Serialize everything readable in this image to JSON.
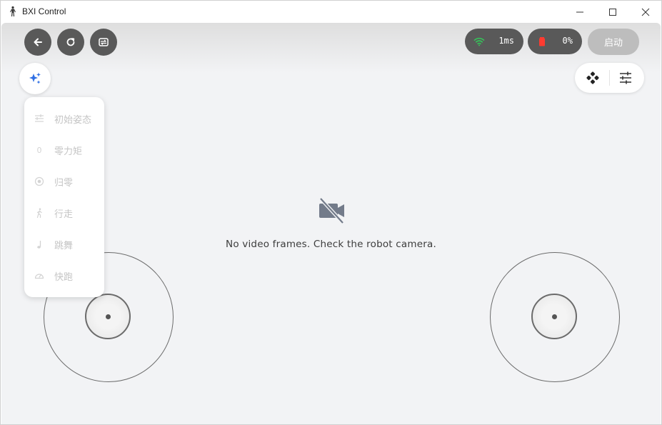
{
  "window": {
    "title": "BXI Control",
    "icons": {
      "app": "robot-figure-icon",
      "minimize": "minimize-icon",
      "maximize": "maximize-icon",
      "close": "close-icon"
    }
  },
  "toolbar": {
    "back_icon": "arrow-left-icon",
    "refresh_icon": "refresh-icon",
    "switch_icon": "switch-icon",
    "latency": {
      "icon": "wifi-icon",
      "value": "1ms",
      "icon_color": "#34c759"
    },
    "battery": {
      "icon": "battery-icon",
      "value": "0%",
      "icon_color": "#ff3b30"
    },
    "start_label": "启动"
  },
  "side_controls": {
    "magic_icon": "sparkle-icon",
    "magic_color": "#2f6fe4",
    "gamepad_icon": "gamepad-icon",
    "settings_icon": "sliders-icon"
  },
  "mode_menu": {
    "items": [
      {
        "label": "初始姿态",
        "icon": "sliders-icon"
      },
      {
        "label": "零力矩",
        "icon": "zero-icon",
        "icon_text": "0"
      },
      {
        "label": "归零",
        "icon": "target-icon"
      },
      {
        "label": "行走",
        "icon": "walk-icon"
      },
      {
        "label": "跳舞",
        "icon": "music-note-icon"
      },
      {
        "label": "快跑",
        "icon": "speedometer-icon"
      }
    ]
  },
  "video": {
    "icon": "video-off-icon",
    "message": "No video frames. Check the robot camera."
  },
  "joysticks": {
    "left": {
      "name": "left-joystick"
    },
    "right": {
      "name": "right-joystick"
    }
  }
}
